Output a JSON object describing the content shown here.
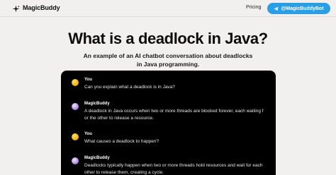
{
  "nav": {
    "brand": "MagicBuddy",
    "pricing": "Pricing",
    "telegram_button": "@MagicBuddyBot"
  },
  "hero": {
    "title": "What is a deadlock in Java?",
    "subtitle_line1": "An example of an AI chatbot conversation about deadlocks",
    "subtitle_line2": "in Java programming."
  },
  "chat": {
    "messages": [
      {
        "sender": "You",
        "text": "Can you explain what a deadlock is in Java?"
      },
      {
        "sender": "MagicBuddy",
        "line1": "A deadlock in Java occurs when two or more threads are blocked forever, each waiting f",
        "line2": "or the other to release a resource."
      },
      {
        "sender": "You",
        "text": "What causes a deadlock to happen?"
      },
      {
        "sender": "MagicBuddy",
        "line1": "Deadlocks typically happen when two or more threads hold resources and wait for each",
        "line2": "other to release them, creating a cycle."
      }
    ]
  },
  "colors": {
    "page_bg": "#f1f0ef",
    "telegram_blue": "#2a9fe6",
    "chat_bg": "#000000"
  },
  "icons": {
    "brand": "sparkle-icon",
    "telegram": "telegram-plane-icon"
  }
}
